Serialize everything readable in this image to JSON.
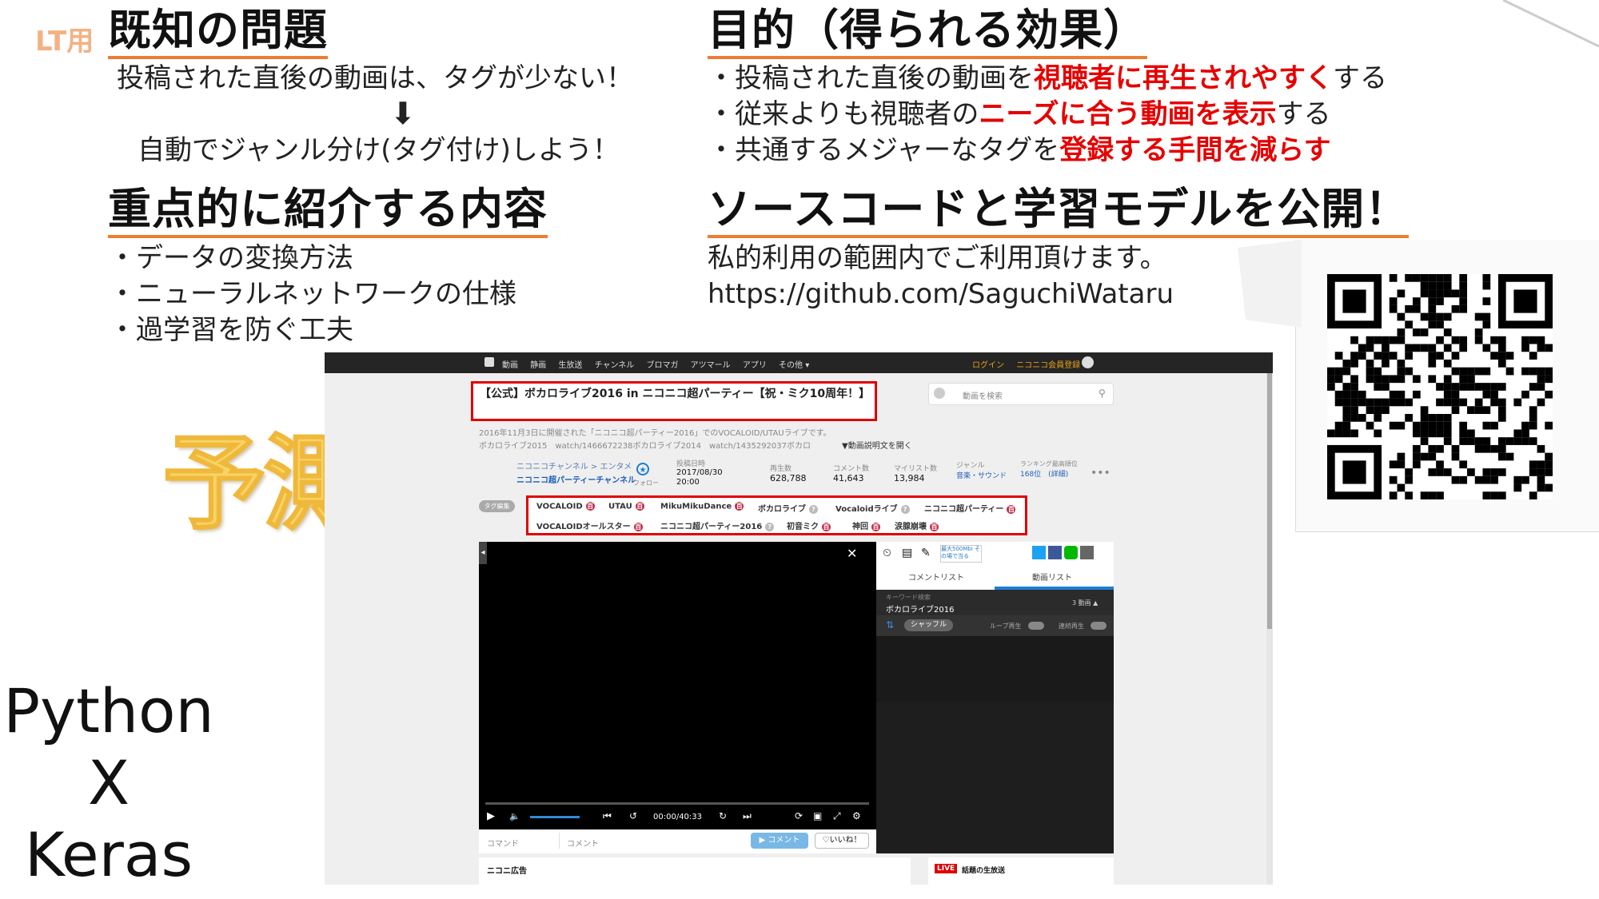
{
  "slide": {
    "lt_label": "LT用",
    "known_problem": {
      "heading": "既知の問題",
      "line1": "投稿された直後の動画は、タグが少ない！",
      "arrow": "⬇",
      "line2": "自動でジャンル分け(タグ付け)しよう！"
    },
    "purpose": {
      "heading": "目的（得られる効果）",
      "items": [
        {
          "pre": "・投稿された直後の動画を",
          "em": "視聴者に再生されやすく",
          "post": "する"
        },
        {
          "pre": "・従来よりも視聴者の",
          "em": "ニーズに合う動画を表示",
          "post": "する"
        },
        {
          "pre": "・共通するメジャーなタグを",
          "em": "登録する手間を減らす",
          "post": ""
        }
      ]
    },
    "focus": {
      "heading": "重点的に紹介する内容",
      "items": [
        "・データの変換方法",
        "・ニューラルネットワークの仕様",
        "・過学習を防ぐ工夫"
      ]
    },
    "publish": {
      "heading": "ソースコードと学習モデルを公開！",
      "line1": "私的利用の範囲内でご利用頂けます。",
      "url": "https://github.com/SaguchiWataru"
    },
    "yosoku": "予測",
    "python": "Python",
    "x": "X",
    "keras": "Keras",
    "colors": {
      "accent_underline": "#ed7d31",
      "emphasis": "#e60000",
      "yosoku": "#f6d365"
    }
  },
  "screenshot": {
    "nav": [
      "動画",
      "静画",
      "生放送",
      "チャンネル",
      "ブロマガ",
      "アツマール",
      "アプリ",
      "その他 ▾"
    ],
    "login": "ログイン",
    "register": "ニコニコ会員登録",
    "title": "【公式】ボカロライブ2016 in ニコニコ超パーティー【祝・ミク10周年！】",
    "search_placeholder": "動画を検索",
    "desc1": "2016年11月3日に開催された「ニコニコ超パーティー2016」でのVOCALOID/UTAUライブです。",
    "desc2": "ボカロライブ2015　watch/1466672238ボカロライブ2014　watch/1435292037ボカロ",
    "desc_more": "▼動画説明文を開く",
    "channel_path": "ニコニコチャンネル > エンタメ",
    "channel_name": "ニコニコ超パーティーチャンネル",
    "follow": "フォロー",
    "stats": [
      {
        "label": "投稿日時",
        "value": "2017/08/30 20:00"
      },
      {
        "label": "再生数",
        "value": "628,788"
      },
      {
        "label": "コメント数",
        "value": "41,643"
      },
      {
        "label": "マイリスト数",
        "value": "13,984"
      },
      {
        "label": "ジャンル",
        "value": "音楽・サウンド"
      },
      {
        "label": "ランキング最高順位",
        "value": "168位　(詳細)"
      }
    ],
    "tag_edit": "タグ編集",
    "tags_row1": [
      "VOCALOID",
      "UTAU",
      "MikuMikuDance",
      "ボカロライブ",
      "Vocaloidライブ",
      "ニコニコ超パーティー"
    ],
    "tags_row2": [
      "VOCALOIDオールスター",
      "ニコニコ超パーティー2016",
      "初音ミク",
      "神回",
      "涙腺崩壊"
    ],
    "time": "00:00/40:33",
    "comment_cmd": "コマンド",
    "comment_placeholder": "コメント",
    "comment_btn": "コメント",
    "like_btn": "♡いいね！",
    "side_tabs": [
      "コメントリスト",
      "動画リスト"
    ],
    "side_promo": "最大500Mbi その場で当る",
    "keyword_label": "キーワード検索",
    "keyword": "ボカロライブ2016",
    "count": "3 動画 ▲",
    "shuffle": "シャッフル",
    "loop": "ループ再生",
    "autoplay": "連続再生",
    "ad_label": "ニコニ広告",
    "live_badge": "LIVE",
    "live_label": "話題の生放送"
  }
}
